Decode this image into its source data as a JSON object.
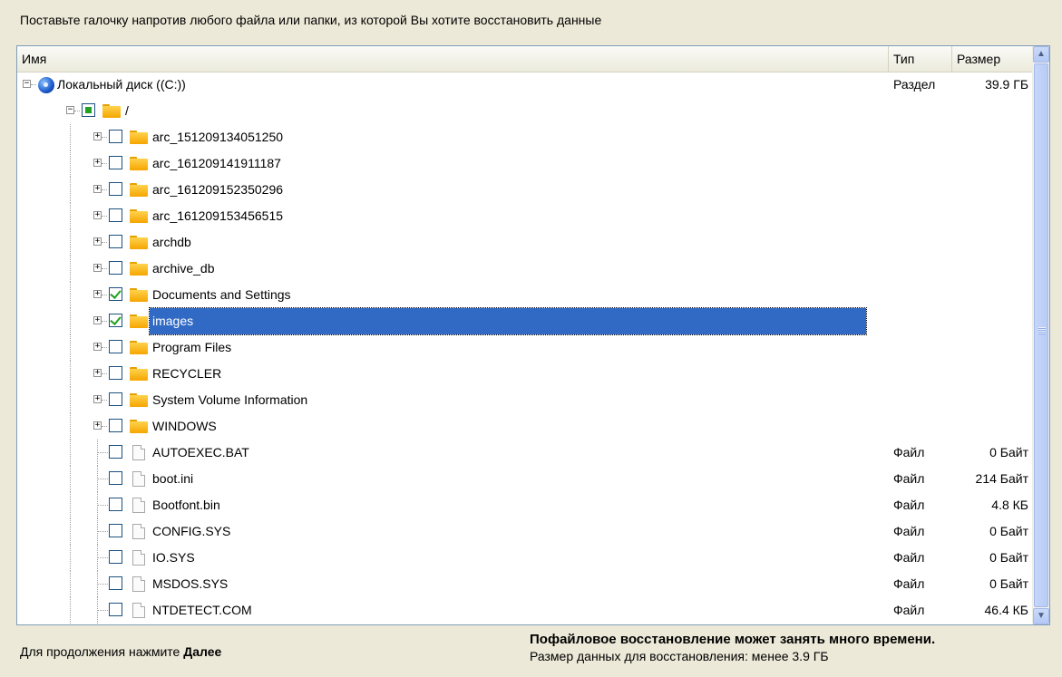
{
  "instruction": "Поставьте галочку напротив любого файла или папки, из которой Вы хотите восстановить данные",
  "columns": {
    "name": "Имя",
    "type": "Тип",
    "size": "Размер"
  },
  "tree": [
    {
      "label": "Локальный диск ((C:))",
      "icon": "disk-icon",
      "level": 0,
      "expander": "minus",
      "checkbox": "none",
      "type": "Раздел",
      "size": "39.9 ГБ"
    },
    {
      "label": "/",
      "icon": "folder-icon",
      "level": 1,
      "expander": "minus",
      "checkbox": "partial",
      "type": "",
      "size": ""
    },
    {
      "label": "arc_151209134051250",
      "icon": "folder-icon",
      "level": 2,
      "expander": "plus",
      "checkbox": "unchecked",
      "type": "",
      "size": ""
    },
    {
      "label": "arc_161209141911187",
      "icon": "folder-icon",
      "level": 2,
      "expander": "plus",
      "checkbox": "unchecked",
      "type": "",
      "size": ""
    },
    {
      "label": "arc_161209152350296",
      "icon": "folder-icon",
      "level": 2,
      "expander": "plus",
      "checkbox": "unchecked",
      "type": "",
      "size": ""
    },
    {
      "label": "arc_161209153456515",
      "icon": "folder-icon",
      "level": 2,
      "expander": "plus",
      "checkbox": "unchecked",
      "type": "",
      "size": ""
    },
    {
      "label": "archdb",
      "icon": "folder-icon",
      "level": 2,
      "expander": "plus",
      "checkbox": "unchecked",
      "type": "",
      "size": ""
    },
    {
      "label": "archive_db",
      "icon": "folder-icon",
      "level": 2,
      "expander": "plus",
      "checkbox": "unchecked",
      "type": "",
      "size": ""
    },
    {
      "label": "Documents and Settings",
      "icon": "folder-icon",
      "level": 2,
      "expander": "plus",
      "checkbox": "checked",
      "type": "",
      "size": ""
    },
    {
      "label": "images",
      "icon": "folder-icon",
      "level": 2,
      "expander": "plus",
      "checkbox": "checked",
      "type": "",
      "size": "",
      "selected": true
    },
    {
      "label": "Program Files",
      "icon": "folder-icon",
      "level": 2,
      "expander": "plus",
      "checkbox": "unchecked",
      "type": "",
      "size": ""
    },
    {
      "label": "RECYCLER",
      "icon": "folder-icon",
      "level": 2,
      "expander": "plus",
      "checkbox": "unchecked",
      "type": "",
      "size": ""
    },
    {
      "label": "System Volume Information",
      "icon": "folder-icon",
      "level": 2,
      "expander": "plus",
      "checkbox": "unchecked",
      "type": "",
      "size": ""
    },
    {
      "label": "WINDOWS",
      "icon": "folder-icon",
      "level": 2,
      "expander": "plus",
      "checkbox": "unchecked",
      "type": "",
      "size": ""
    },
    {
      "label": "AUTOEXEC.BAT",
      "icon": "file-icon",
      "level": 2,
      "expander": "none",
      "checkbox": "unchecked",
      "type": "Файл",
      "size": "0 Байт"
    },
    {
      "label": "boot.ini",
      "icon": "file-icon",
      "level": 2,
      "expander": "none",
      "checkbox": "unchecked",
      "type": "Файл",
      "size": "214 Байт"
    },
    {
      "label": "Bootfont.bin",
      "icon": "file-icon",
      "level": 2,
      "expander": "none",
      "checkbox": "unchecked",
      "type": "Файл",
      "size": "4.8 КБ"
    },
    {
      "label": "CONFIG.SYS",
      "icon": "file-icon",
      "level": 2,
      "expander": "none",
      "checkbox": "unchecked",
      "type": "Файл",
      "size": "0 Байт"
    },
    {
      "label": "IO.SYS",
      "icon": "file-icon",
      "level": 2,
      "expander": "none",
      "checkbox": "unchecked",
      "type": "Файл",
      "size": "0 Байт"
    },
    {
      "label": "MSDOS.SYS",
      "icon": "file-icon",
      "level": 2,
      "expander": "none",
      "checkbox": "unchecked",
      "type": "Файл",
      "size": "0 Байт"
    },
    {
      "label": "NTDETECT.COM",
      "icon": "file-icon",
      "level": 2,
      "expander": "none",
      "checkbox": "unchecked",
      "type": "Файл",
      "size": "46.4 КБ"
    }
  ],
  "footer": {
    "continue_prefix": "Для продолжения нажмите",
    "continue_action": "Далее",
    "warning": "Пофайловое восстановление может занять много времени.",
    "data_size": "Размер данных для восстановления: менее 3.9 ГБ"
  },
  "colors": {
    "selection": "#316ac5",
    "check": "#21a121",
    "background": "#ece9d8"
  }
}
